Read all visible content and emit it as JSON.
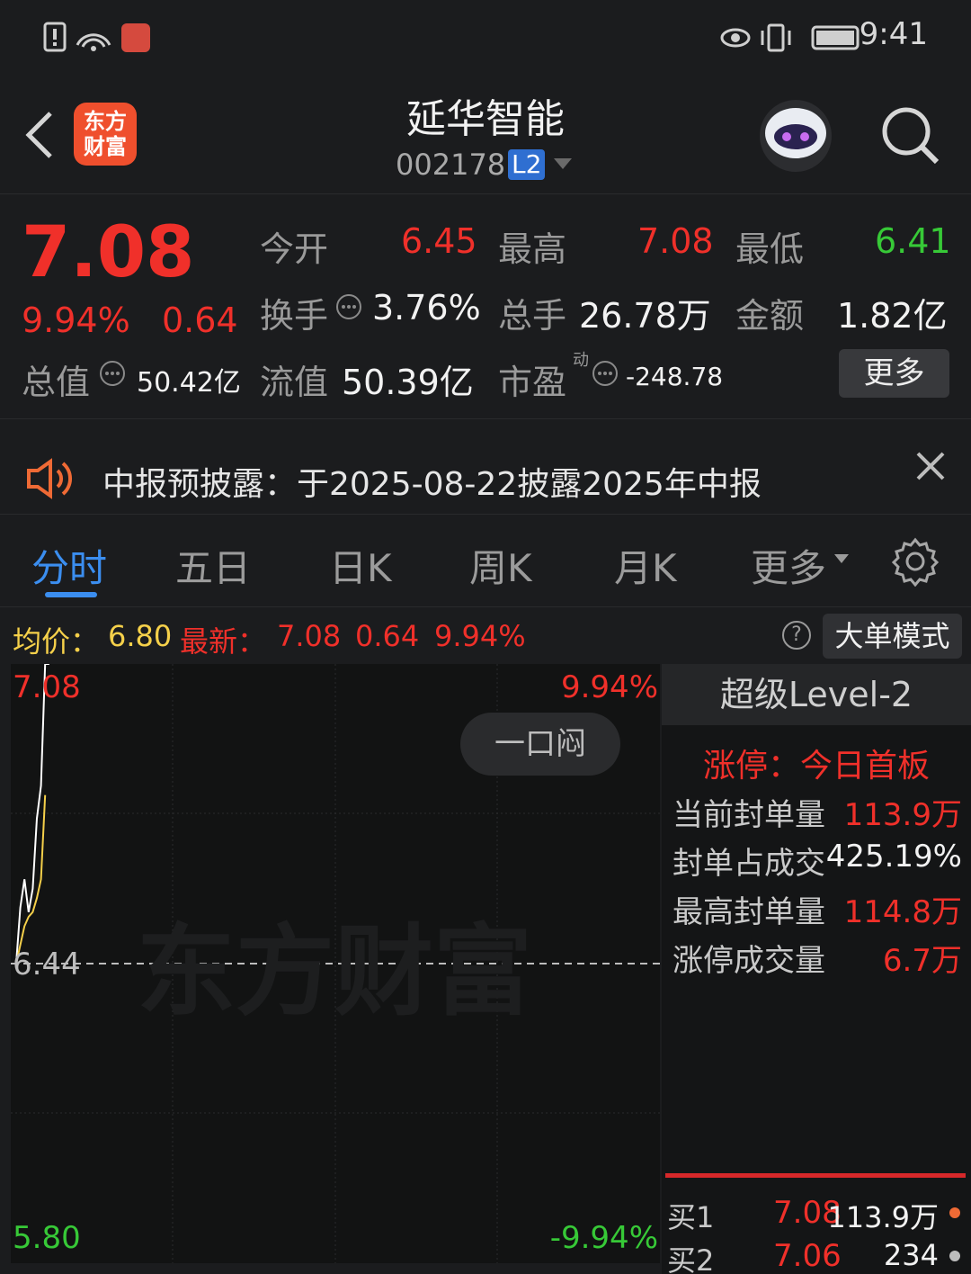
{
  "status_bar": {
    "time": "9:41"
  },
  "header": {
    "logo_text": "东方财富",
    "title": "延华智能",
    "code": "002178",
    "badge": "L2"
  },
  "quote": {
    "price": "7.08",
    "change_pct": "9.94%",
    "change": "0.64",
    "open_label": "今开",
    "open": "6.45",
    "high_label": "最高",
    "high": "7.08",
    "low_label": "最低",
    "low": "6.41",
    "turnover_label": "换手",
    "turnover": "3.76%",
    "volume_label": "总手",
    "volume": "26.78万",
    "amount_label": "金额",
    "amount": "1.82亿",
    "mktcap_label": "总值",
    "mktcap": "50.42亿",
    "float_label": "流值",
    "float": "50.39亿",
    "pe_label": "市盈",
    "pe_sup": "动",
    "pe": "-248.78",
    "more_label": "更多"
  },
  "notice": {
    "text": "中报预披露：于2025-08-22披露2025年中报"
  },
  "tabs": [
    "分时",
    "五日",
    "日K",
    "周K",
    "月K",
    "更多"
  ],
  "info_line": {
    "avg_label": "均价：",
    "avg": "6.80",
    "latest_label": "最新：",
    "latest": "7.08",
    "change": "0.64",
    "pct": "9.94%",
    "help": "?",
    "big_order_label": "大单模式"
  },
  "chart": {
    "y_top": "7.08",
    "y_mid": "6.44",
    "y_bottom": "5.80",
    "pct_top": "9.94%",
    "pct_bottom": "-9.94%",
    "watermark": "东方财富",
    "one_look_label": "一口闷",
    "colors": {
      "price_line": "#ffffff",
      "avg_line": "#f5d04a",
      "up": "#f0302a",
      "down": "#37c937"
    }
  },
  "chart_data": {
    "type": "line",
    "title": "",
    "xlabel": "",
    "ylabel": "",
    "ylim": [
      5.8,
      7.08
    ],
    "series": [
      {
        "values": [
          6.44,
          6.56,
          6.62,
          6.55,
          6.6,
          6.75,
          6.82,
          7.08,
          7.08
        ]
      },
      {
        "values": [
          6.44,
          6.48,
          6.52,
          6.54,
          6.55,
          6.58,
          6.62,
          6.8
        ]
      }
    ]
  },
  "level2": {
    "header": "超级Level-2",
    "limit_status": "涨停：今日首板",
    "rows": [
      {
        "label": "当前封单量",
        "value": "113.9万"
      },
      {
        "label": "封单占成交",
        "value": "425.19%"
      },
      {
        "label": "最高封单量",
        "value": "114.8万"
      },
      {
        "label": "涨停成交量",
        "value": "6.7万"
      }
    ],
    "bids": [
      {
        "label": "买1",
        "price": "7.08",
        "volume": "113.9万"
      },
      {
        "label": "买2",
        "price": "7.06",
        "volume": "234"
      }
    ]
  }
}
